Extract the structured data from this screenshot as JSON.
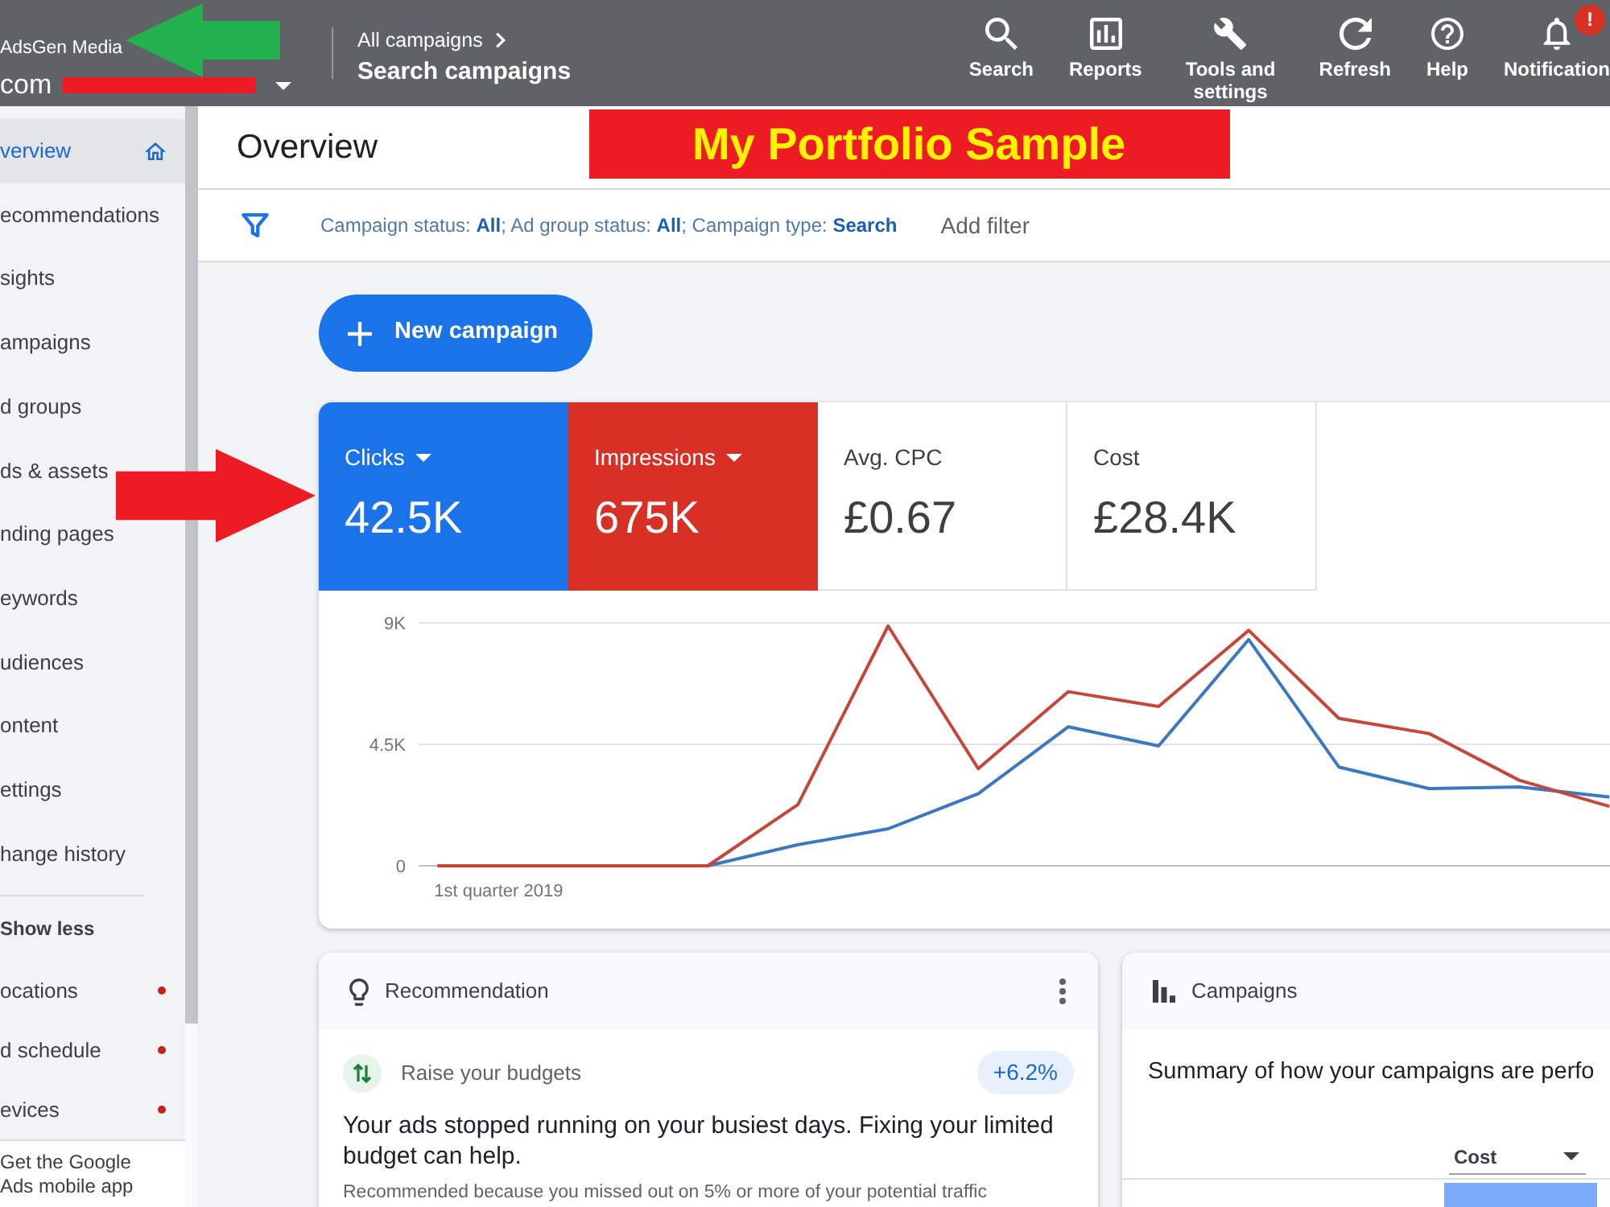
{
  "top_bar": {
    "account": {
      "name": "AdsGen Media",
      "label": "com",
      "redacted": true
    },
    "breadcrumb": "All campaigns",
    "view_title": "Search campaigns",
    "actions": [
      {
        "label": "Search"
      },
      {
        "label": "Reports"
      },
      {
        "label": "Tools and settings"
      },
      {
        "label": "Refresh"
      },
      {
        "label": "Help"
      },
      {
        "label": "Notification",
        "badge": "!"
      }
    ]
  },
  "annotations": [
    {
      "kind": "left-arrow",
      "color": "#22b14c"
    },
    {
      "kind": "right-arrow",
      "color": "#ed1c24"
    }
  ],
  "banner": {
    "text": "My Portfolio Sample"
  },
  "sidebar": {
    "items": [
      {
        "label": "verview",
        "selected": true
      },
      {
        "label": "ecommendations",
        "selected": false
      },
      {
        "label": "sights",
        "selected": false
      },
      {
        "label": "ampaigns",
        "selected": false
      },
      {
        "label": "d groups",
        "selected": false
      },
      {
        "label": "ds & assets",
        "selected": false
      },
      {
        "label": "nding pages",
        "selected": false
      },
      {
        "label": "eywords",
        "selected": false
      },
      {
        "label": "udiences",
        "selected": false
      },
      {
        "label": "ontent",
        "selected": false
      },
      {
        "label": "ettings",
        "selected": false
      },
      {
        "label": "hange history",
        "selected": false
      }
    ],
    "toggle": "Show less",
    "more_items": [
      {
        "label": "ocations",
        "selected": false,
        "alert": true
      },
      {
        "label": "d schedule",
        "selected": false,
        "alert": true
      },
      {
        "label": "evices",
        "selected": false,
        "alert": true
      }
    ],
    "promo": "Get the Google Ads mobile app"
  },
  "page_title": "Overview",
  "filter": {
    "summary": "Campaign status: **All**; Ad group status: **All**; Campaign type: **Search**",
    "add_label": "Add filter"
  },
  "new_campaign_button": "New campaign",
  "performance": {
    "metrics": [
      {
        "label": "Clicks",
        "value": "42.5K",
        "selected": true,
        "color": "#1a73e8"
      },
      {
        "label": "Impressions",
        "value": "675K",
        "selected": true,
        "color": "#d93025"
      },
      {
        "label": "Avg. CPC",
        "value": "£0.67",
        "selected": false
      },
      {
        "label": "Cost",
        "value": "£28.4K",
        "selected": false
      }
    ],
    "chart_data": {
      "type": "line",
      "xlabel": "1st quarter 2019",
      "ylim": [
        0,
        9000
      ],
      "yticks": [
        {
          "value": 0,
          "label": "0"
        },
        {
          "value": 4500,
          "label": "4.5K"
        },
        {
          "value": 9000,
          "label": "9K"
        }
      ],
      "series": [
        {
          "color": "#3c78c0",
          "values": [
            null,
            null,
            null,
            0,
            780,
            1370,
            2670,
            5150,
            4440,
            8380,
            3660,
            2860,
            2920,
            2550
          ]
        },
        {
          "color": "#c5473a",
          "values": [
            0,
            0,
            0,
            0,
            2270,
            8880,
            3600,
            6450,
            5900,
            8720,
            5460,
            4900,
            3170,
            2200
          ]
        }
      ]
    }
  },
  "recommendation": {
    "title": "Recommendation",
    "item": {
      "title": "Raise your budgets",
      "uplift": "+6.2%",
      "headline": "Your ads stopped running on your busiest days. Fixing your limited budget can help.",
      "reason": "Recommended because you missed out on 5% or more of your potential traffic"
    }
  },
  "campaigns": {
    "title": "Campaigns",
    "summary": "Summary of how your campaigns are perfo",
    "sort_metric": "Cost"
  }
}
